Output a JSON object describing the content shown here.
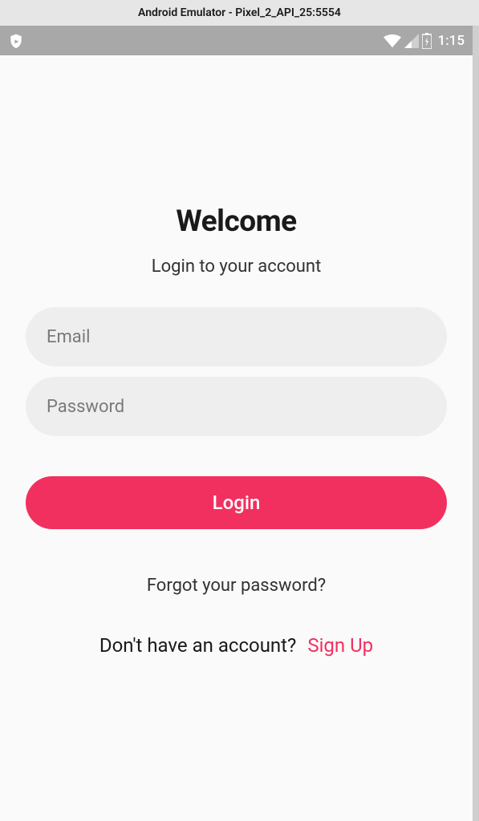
{
  "emulator": {
    "title": "Android Emulator - Pixel_2_API_25:5554"
  },
  "statusbar": {
    "time": "1:15"
  },
  "login": {
    "title": "Welcome",
    "subtitle": "Login to your account",
    "email_placeholder": "Email",
    "password_placeholder": "Password",
    "login_button": "Login",
    "forgot_link": "Forgot your password?",
    "signup_prompt": "Don't have an account?",
    "signup_link": "Sign Up"
  },
  "colors": {
    "accent": "#f2305f",
    "input_bg": "#eeeeee",
    "app_bg": "#fafafa",
    "statusbar_bg": "#a8a8a8"
  }
}
